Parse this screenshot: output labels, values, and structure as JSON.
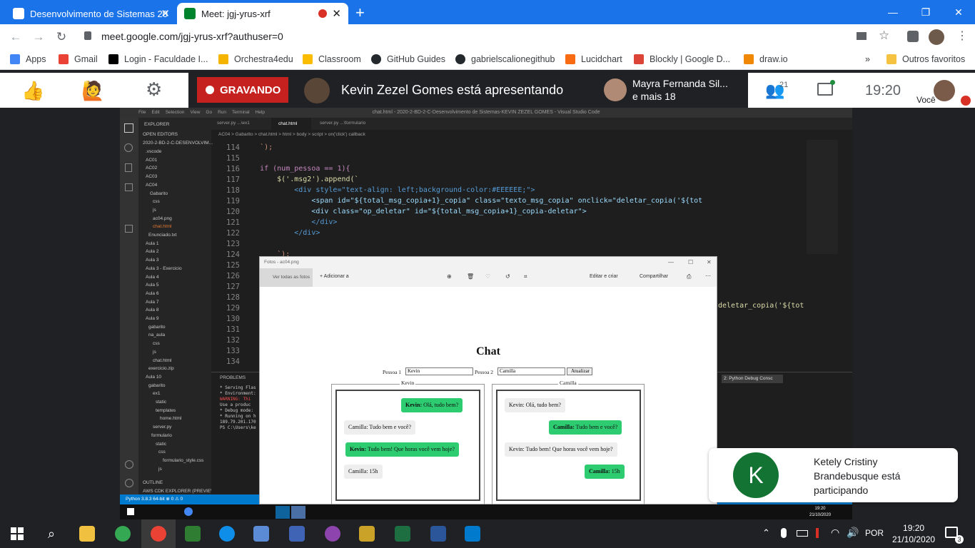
{
  "browser": {
    "tabs": [
      {
        "label": "Desenvolvimento de Sistemas 20"
      },
      {
        "label": "Meet: jgj-yrus-xrf"
      }
    ],
    "url": "meet.google.com/jgj-yrus-xrf?authuser=0",
    "bookmarks": [
      "Apps",
      "Gmail",
      "Login - Faculdade I...",
      "Orchestra4edu",
      "Classroom",
      "GitHub Guides",
      "gabrielscalionegithub",
      "Lucidchart",
      "Blockly | Google D...",
      "draw.io"
    ],
    "other_bookmarks": "Outros favoritos"
  },
  "meet": {
    "recording": "GRAVANDO",
    "presenting": "Kevin Zezel Gomes está apresentando",
    "participant_name": "Mayra Fernanda Sil...",
    "participant_more": "e mais 18",
    "participant_count": "21",
    "time": "19:20",
    "you": "Você"
  },
  "vscode": {
    "title": "chat.html - 2020-2-BD-2-C-Desenvolvimento de Sistemas-KEVIN ZEZEL GOMES - Visual Studio Code",
    "menu": [
      "File",
      "Edit",
      "Selection",
      "View",
      "Go",
      "Run",
      "Terminal",
      "Help"
    ],
    "explorer_title": "EXPLORER",
    "open_editors": "OPEN EDITORS",
    "root": "2020-2-BD-2-C-DESENVOLVIM...",
    "tree": [
      ".vscode",
      "AC01",
      "AC02",
      "AC03",
      "AC04",
      "Gabarito",
      "css",
      "js",
      "ac04.png",
      "chat.html",
      "Enunciado.txt",
      "Aula 1",
      "Aula 2",
      "Aula 3",
      "Aula 3 - Exercicio",
      "Aula 4",
      "Aula 5",
      "Aula 6",
      "Aula 7",
      "Aula 8",
      "Aula 9",
      "gabarito",
      "na_aula",
      "css",
      "js",
      "chat.html",
      "exercicio.zip",
      "Aula 10",
      "gabarito",
      "ex1",
      "static",
      "templates",
      "home.html",
      "server.py",
      "formulario",
      "static",
      "css",
      "formulario_style.css",
      "js"
    ],
    "outline": "OUTLINE",
    "cdk": "AWS CDK EXPLORER (PREVIEW)",
    "editor_tabs": [
      "server.py ...\\ex1",
      "chat.html",
      "server.py ...\\formulario"
    ],
    "breadcrumb": "AC04 > Gabarito > chat.html > html > body > script > on('click') callback",
    "line_numbers": [
      "114",
      "115",
      "116",
      "117",
      "118",
      "119",
      "120",
      "121",
      "122",
      "123",
      "124",
      "125",
      "126",
      "127",
      "128",
      "129",
      "130",
      "131",
      "132",
      "133",
      "134"
    ],
    "code": [
      "    `);",
      "",
      "    if (num_pessoa == 1){",
      "        $('.msg2').append(`",
      "            <div style=\"text-align: left;background-color:#EEEEEE;\">",
      "                <span id=\"${total_msg_copia+1}_copia\" class=\"texto_msg_copia\" onclick=\"deletar_copia('${tot",
      "                <div class=\"op_deletar\" id=\"${total_msg_copia+1}_copia-deletar\">",
      "                </div>",
      "            </div>",
      "",
      "        `);"
    ],
    "code_right": "deletar_copia('${tot",
    "panel_tab": "PROBLEMS",
    "terminal_select": "2: Python Debug Consc",
    "terminal": [
      "* Serving Flas",
      "* Environment:",
      "  WARNING: Thi",
      "  Use a produc",
      "* Debug mode:",
      "* Running on h",
      "189.79.201.170",
      "PS C:\\Users\\ke"
    ],
    "status": "Python 3.8.3 64-bit    ⊗ 0 ⚠ 0"
  },
  "photos": {
    "title": "Fotos - ac04.png",
    "see_all": "Ver todas as fotos",
    "add": "Adicionar a",
    "edit": "Editar e criar",
    "share": "Compartilhar",
    "chat_title": "Chat",
    "p1_label": "Pessoa 1",
    "p1_value": "Kevin",
    "p2_label": "Pessoa 2",
    "p2_value": "Camilla",
    "update": "Atualizar",
    "left_legend": "Kevin",
    "right_legend": "Camilla",
    "left_msgs": [
      {
        "who": "Kevin:",
        "text": " Olá, tudo bem?"
      },
      {
        "who": "",
        "text": "Camilla: Tudo bem e você?"
      },
      {
        "who": "Kevin:",
        "text": " Tudo bem! Que horas você vem hoje?"
      },
      {
        "who": "",
        "text": "Camilla: 15h"
      }
    ],
    "right_msgs": [
      {
        "who": "",
        "text": "Kevin: Olá, tudo bem?"
      },
      {
        "who": "Camilla:",
        "text": " Tudo bem e você?"
      },
      {
        "who": "",
        "text": "Kevin: Tudo bem! Que horas você vem hoje?"
      },
      {
        "who": "Camilla:",
        "text": " 15h"
      }
    ]
  },
  "inner_taskbar": {
    "time": "19:20",
    "date": "21/10/2020"
  },
  "toast": {
    "initial": "K",
    "text": "Ketely Cristiny Brandebusque está participando"
  },
  "taskbar": {
    "lang": "POR",
    "time": "19:20",
    "date": "21/10/2020",
    "notifications": "3"
  }
}
